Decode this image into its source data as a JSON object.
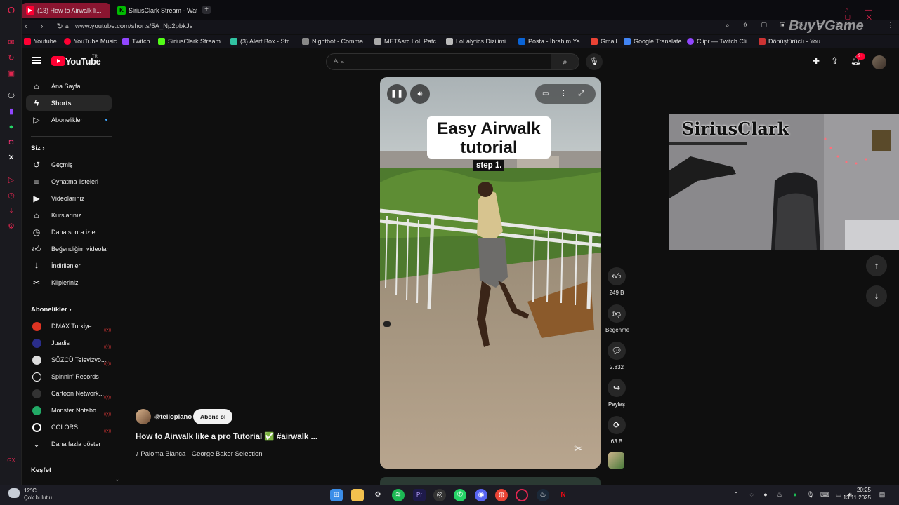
{
  "browser": {
    "tabs": [
      {
        "title": "(13) How to Airwalk li..."
      },
      {
        "title": "SiriusClark Stream - Wat..."
      }
    ],
    "url": "www.youtube.com/shorts/5A_Np2pbkJs",
    "bookmarks": [
      "Youtube",
      "YouTube Music",
      "Twitch",
      "SiriusClark Stream...",
      "(3) Alert Box - Str...",
      "Nightbot - Comma...",
      "METAsrc LoL Patc...",
      "LoLalytics Dizilimi...",
      "Posta - İbrahim Ya...",
      "Gmail",
      "Google Translate",
      "Clipr — Twitch Cli...",
      "Dönüştürücü - You..."
    ],
    "watermark": "BuyVGame"
  },
  "youtube": {
    "logo": "YouTube",
    "region": "TR",
    "search_placeholder": "Ara",
    "notification_count": "9+",
    "sidebar": {
      "main": [
        "Ana Sayfa",
        "Shorts",
        "Abonelikler"
      ],
      "you_title": "Siz",
      "you": [
        "Geçmiş",
        "Oynatma listeleri",
        "Videolarınız",
        "Kurslarınız",
        "Daha sonra izle",
        "Beğendiğim videolar",
        "İndirilenler",
        "Klipleriniz"
      ],
      "subs_title": "Abonelikler",
      "subs": [
        "DMAX Turkiye",
        "Juadis",
        "SÖZCÜ Televizyo...",
        "Spinnin' Records",
        "Cartoon Network...",
        "Monster Notebo...",
        "COLORS"
      ],
      "show_more": "Daha fazla göster",
      "explore_title": "Keşfet"
    },
    "short": {
      "overlay_title": "Easy Airwalk tutorial",
      "overlay_title_line1": "Easy Airwalk",
      "overlay_title_line2": "tutorial",
      "overlay_step": "step 1.",
      "channel": "@tellopiano",
      "subscribe": "Abone ol",
      "title": "How to Airwalk like a pro  Tutorial ✅ #airwalk ...",
      "music": "♪ Paloma Blanca · George Baker Selection"
    },
    "actions": {
      "likes": "249 B",
      "dislike": "Beğenme",
      "comments": "2.832",
      "share": "Paylaş",
      "remix": "63 B"
    }
  },
  "webcam": {
    "overlay_text": "SiriusClark"
  },
  "taskbar": {
    "weather_temp": "12°C",
    "weather_desc": "Çok bulutlu",
    "time": "20:25",
    "date": "13.11.2025"
  },
  "colors": {
    "youtube_red": "#ff0033",
    "opera_red": "#e0264f",
    "background": "#0f0f0f"
  }
}
